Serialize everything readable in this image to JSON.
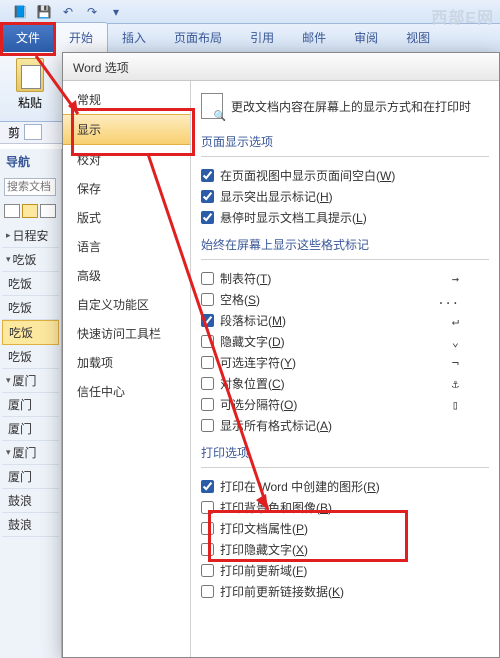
{
  "watermark": "西部E网",
  "qat": {
    "save": "💾",
    "undo": "↶",
    "redo": "↷",
    "more": "▾"
  },
  "tabs": {
    "file": "文件",
    "items": [
      "开始",
      "插入",
      "页面布局",
      "引用",
      "邮件",
      "审阅",
      "视图"
    ]
  },
  "ribbon": {
    "paste": "粘贴"
  },
  "subtool": {
    "cut": "剪"
  },
  "nav": {
    "title": "导航",
    "search_ph": "搜索文档",
    "items": [
      {
        "t": "日程安",
        "exp": "▸"
      },
      {
        "t": "吃饭",
        "exp": "▾"
      },
      {
        "t": "吃饭",
        "exp": ""
      },
      {
        "t": "吃饭",
        "exp": ""
      },
      {
        "t": "吃饭",
        "exp": "",
        "sel": true
      },
      {
        "t": "吃饭",
        "exp": ""
      },
      {
        "t": "厦门",
        "exp": "▾"
      },
      {
        "t": "厦门",
        "exp": ""
      },
      {
        "t": "厦门",
        "exp": ""
      },
      {
        "t": "厦门",
        "exp": "▾"
      },
      {
        "t": "厦门",
        "exp": ""
      },
      {
        "t": "鼓浪",
        "exp": ""
      },
      {
        "t": "鼓浪",
        "exp": ""
      }
    ]
  },
  "dialog": {
    "title": "Word 选项",
    "side": [
      "常规",
      "显示",
      "校对",
      "保存",
      "版式",
      "语言",
      "高级",
      "自定义功能区",
      "快速访问工具栏",
      "加载项",
      "信任中心"
    ],
    "side_sel": 1,
    "header": "更改文档内容在屏幕上的显示方式和在打印时",
    "sec1": {
      "title": "页面显示选项",
      "opts": [
        {
          "c": true,
          "l": "在页面视图中显示页面间空白(",
          "k": "W",
          "r": ")"
        },
        {
          "c": true,
          "l": "显示突出显示标记(",
          "k": "H",
          "r": ")"
        },
        {
          "c": true,
          "l": "悬停时显示文档工具提示(",
          "k": "L",
          "r": ")"
        }
      ]
    },
    "sec2": {
      "title": "始终在屏幕上显示这些格式标记",
      "opts": [
        {
          "c": false,
          "l": "制表符(",
          "k": "T",
          "r": ")",
          "s": "→"
        },
        {
          "c": false,
          "l": "空格(",
          "k": "S",
          "r": ")",
          "s": "..."
        },
        {
          "c": true,
          "l": "段落标记(",
          "k": "M",
          "r": ")",
          "s": "↵"
        },
        {
          "c": false,
          "l": "隐藏文字(",
          "k": "D",
          "r": ")",
          "s": "⌄"
        },
        {
          "c": false,
          "l": "可选连字符(",
          "k": "Y",
          "r": ")",
          "s": "¬"
        },
        {
          "c": false,
          "l": "对象位置(",
          "k": "C",
          "r": ")",
          "s": "⚓"
        },
        {
          "c": false,
          "l": "可选分隔符(",
          "k": "O",
          "r": ")",
          "s": "▯"
        },
        {
          "c": false,
          "l": "显示所有格式标记(",
          "k": "A",
          "r": ")"
        }
      ]
    },
    "sec3": {
      "title": "打印选项",
      "opts": [
        {
          "c": true,
          "l": "打印在 Word 中创建的图形(",
          "k": "R",
          "r": ")"
        },
        {
          "c": false,
          "l": "打印背景色和图像(",
          "k": "B",
          "r": ")"
        },
        {
          "c": false,
          "l": "打印文档属性(",
          "k": "P",
          "r": ")"
        },
        {
          "c": false,
          "l": "打印隐藏文字(",
          "k": "X",
          "r": ")"
        },
        {
          "c": false,
          "l": "打印前更新域(",
          "k": "F",
          "r": ")"
        },
        {
          "c": false,
          "l": "打印前更新链接数据(",
          "k": "K",
          "r": ")"
        }
      ]
    }
  }
}
